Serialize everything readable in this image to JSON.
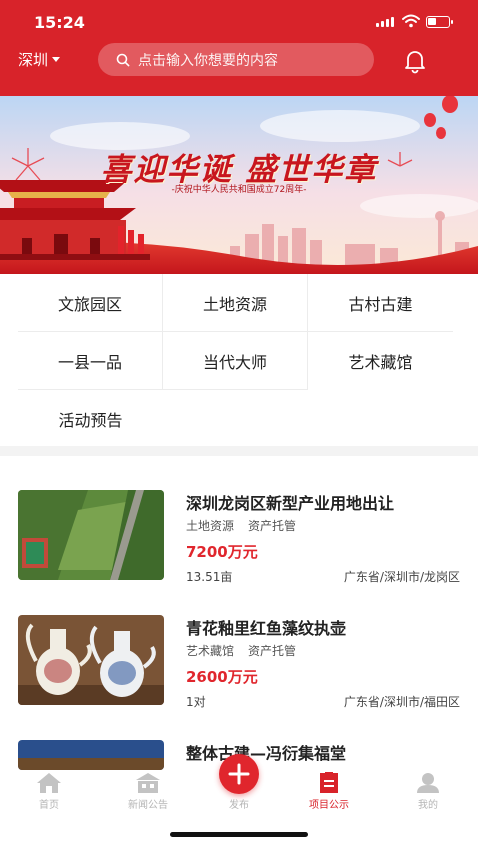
{
  "status_bar": {
    "time": "15:24"
  },
  "header": {
    "city": "深圳",
    "search_placeholder": "点击输入你想要的内容"
  },
  "banner": {
    "title": "喜迎华诞 盛世华章",
    "subtitle": "-庆祝中华人民共和国成立72周年-"
  },
  "categories": [
    "文旅园区",
    "土地资源",
    "古村古建",
    "一县一品",
    "当代大师",
    "艺术藏馆",
    "活动预告"
  ],
  "listings": [
    {
      "title": "深圳龙岗区新型产业用地出让",
      "tags": [
        "土地资源",
        "资产托管"
      ],
      "price": "7200万元",
      "size": "13.51亩",
      "location": "广东省/深圳市/龙岗区"
    },
    {
      "title": "青花釉里红鱼藻纹执壶",
      "tags": [
        "艺术藏馆",
        "资产托管"
      ],
      "price": "2600万元",
      "size": "1对",
      "location": "广东省/深圳市/福田区"
    },
    {
      "title": "整体古建—冯衍集福堂",
      "tags": [],
      "price": "",
      "size": "",
      "location": ""
    }
  ],
  "tabbar": {
    "home": "首页",
    "news": "新闻公告",
    "publish": "发布",
    "projects": "项目公示",
    "mine": "我的",
    "active": "projects"
  },
  "colors": {
    "brand_red": "#d8232a",
    "price_red": "#e0262d"
  }
}
